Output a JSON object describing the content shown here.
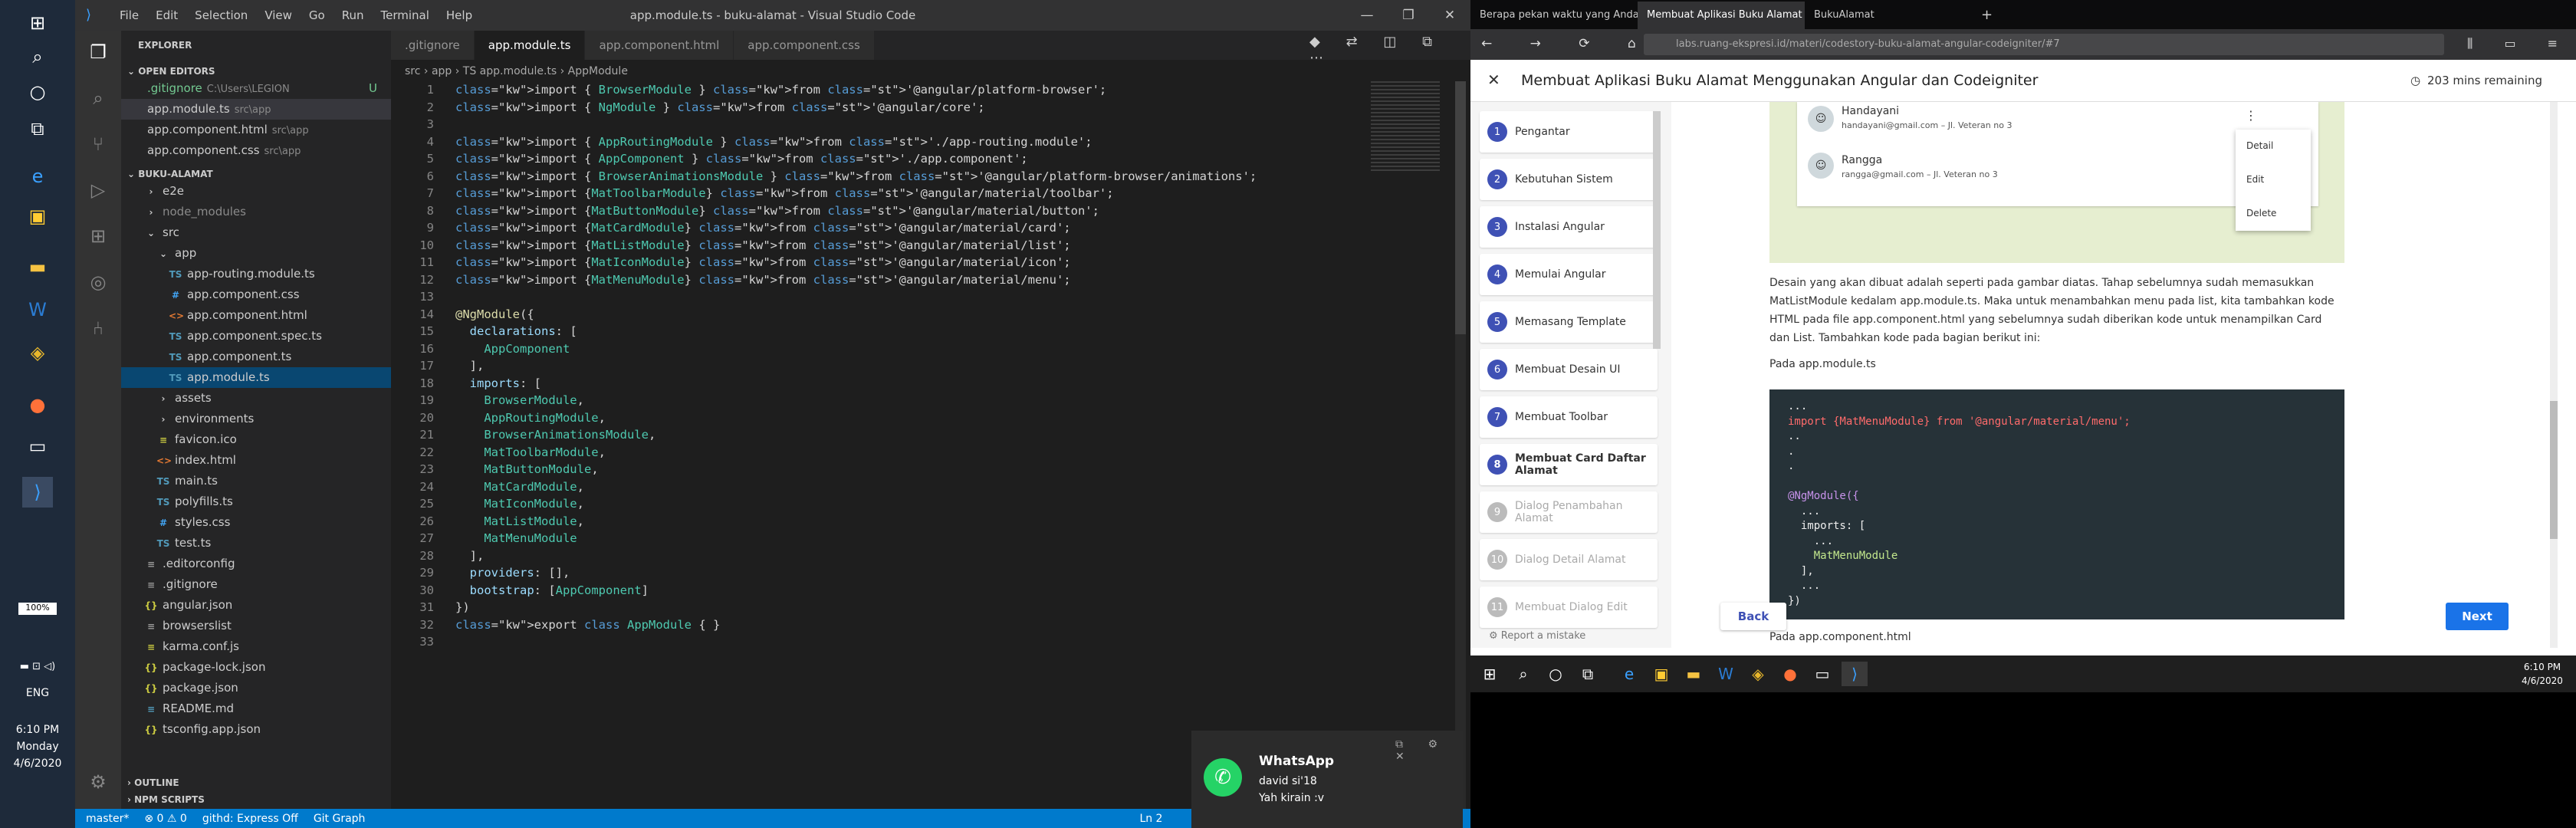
{
  "left_taskbar": {
    "battery": "100%",
    "lang": "ENG",
    "time": "6:10 PM",
    "day": "Monday",
    "date": "4/6/2020"
  },
  "vscode": {
    "menu": [
      "File",
      "Edit",
      "Selection",
      "View",
      "Go",
      "Run",
      "Terminal",
      "Help"
    ],
    "title": "app.module.ts - buku-alamat - Visual Studio Code",
    "tabs": [
      ".gitignore",
      "app.module.ts",
      "app.component.html",
      "app.component.css"
    ],
    "explorer": "EXPLORER",
    "open_editors": "OPEN EDITORS",
    "open_files": [
      {
        "name": ".gitignore",
        "path": "C:\\Users\\LEGION",
        "badge": "U"
      },
      {
        "name": "app.module.ts",
        "path": "src\\app"
      },
      {
        "name": "app.component.html",
        "path": "src\\app"
      },
      {
        "name": "app.component.css",
        "path": "src\\app"
      }
    ],
    "project": "BUKU-ALAMAT",
    "tree": [
      "e2e",
      "node_modules",
      "src",
      "app",
      "app-routing.module.ts",
      "app.component.css",
      "app.component.html",
      "app.component.spec.ts",
      "app.component.ts",
      "app.module.ts",
      "assets",
      "environments",
      "favicon.ico",
      "index.html",
      "main.ts",
      "polyfills.ts",
      "styles.css",
      "test.ts",
      ".editorconfig",
      ".gitignore",
      "angular.json",
      "browserslist",
      "karma.conf.js",
      "package-lock.json",
      "package.json",
      "README.md",
      "tsconfig.app.json"
    ],
    "outline": "OUTLINE",
    "npm": "NPM SCRIPTS",
    "breadcrumb": "src › app › TS app.module.ts › AppModule",
    "code": [
      "import { BrowserModule } from '@angular/platform-browser';",
      "import { NgModule } from '@angular/core';",
      "",
      "import { AppRoutingModule } from './app-routing.module';",
      "import { AppComponent } from './app.component';",
      "import { BrowserAnimationsModule } from '@angular/platform-browser/animations';",
      "import {MatToolbarModule} from '@angular/material/toolbar';",
      "import {MatButtonModule} from '@angular/material/button';",
      "import {MatCardModule} from '@angular/material/card';",
      "import {MatListModule} from '@angular/material/list';",
      "import {MatIconModule} from '@angular/material/icon';",
      "import {MatMenuModule} from '@angular/material/menu';",
      "",
      "@NgModule({",
      "  declarations: [",
      "    AppComponent",
      "  ],",
      "  imports: [",
      "    BrowserModule,",
      "    AppRoutingModule,",
      "    BrowserAnimationsModule,",
      "    MatToolbarModule,",
      "    MatButtonModule,",
      "    MatCardModule,",
      "    MatIconModule,",
      "    MatListModule,",
      "    MatMenuModule",
      "  ],",
      "  providers: [],",
      "  bootstrap: [AppComponent]",
      "})",
      "export class AppModule { }",
      ""
    ],
    "status": {
      "branch": "master*",
      "errors": "⊗ 0 ⚠ 0",
      "github": "githd: Express Off",
      "graph": "Git Graph",
      "pos": "Ln 2"
    },
    "toast": {
      "title": "WhatsApp",
      "line1": "david si'18",
      "line2": "Yah kirain :v"
    }
  },
  "browser": {
    "tabs": [
      "Berapa pekan waktu yang Anda",
      "Membuat Aplikasi Buku Alamat Me",
      "BukuAlamat"
    ],
    "url": "labs.ruang-ekspresi.id/materi/codestory-buku-alamat-angular-codeigniter/#7",
    "course_title": "Membuat Aplikasi Buku Alamat Menggunakan Angular dan Codeigniter",
    "remaining": "203 mins remaining",
    "steps": [
      {
        "n": "1",
        "t": "Pengantar"
      },
      {
        "n": "2",
        "t": "Kebutuhan Sistem"
      },
      {
        "n": "3",
        "t": "Instalasi Angular"
      },
      {
        "n": "4",
        "t": "Memulai Angular"
      },
      {
        "n": "5",
        "t": "Memasang Template"
      },
      {
        "n": "6",
        "t": "Membuat Desain UI"
      },
      {
        "n": "7",
        "t": "Membuat Toolbar"
      },
      {
        "n": "8",
        "t": "Membuat Card Daftar Alamat"
      },
      {
        "n": "9",
        "t": "Dialog Penambahan Alamat"
      },
      {
        "n": "10",
        "t": "Dialog Detail Alamat"
      },
      {
        "n": "11",
        "t": "Membuat Dialog Edit"
      }
    ],
    "report": "Report a mistake",
    "contacts": [
      {
        "name": "Handayani",
        "info": "handayani@gmail.com – Jl. Veteran no 3"
      },
      {
        "name": "Rangga",
        "info": "rangga@gmail.com – Jl. Veteran no 3"
      }
    ],
    "menu": [
      "Detail",
      "Edit",
      "Delete"
    ],
    "para": "Desain yang akan dibuat adalah seperti pada gambar diatas. Tahap sebelumnya sudah memasukkan MatListModule kedalam app.module.ts. Maka untuk menambahkan menu pada list, kita tambahkan kode HTML pada file app.component.html yang sebelumnya sudah diberikan kode untuk menampilkan Card dan List. Tambahkan kode pada bagian berikut ini:",
    "sub1": "Pada app.module.ts",
    "code": [
      "...",
      "import {MatMenuModule} from '@angular/material/menu';",
      "..",
      ".",
      ".",
      "",
      "@NgModule({",
      "  ...",
      "  imports: [",
      "    ...",
      "    MatMenuModule",
      "  ],",
      "  ...",
      "})"
    ],
    "sub2": "Pada app.component.html",
    "back": "Back",
    "next": "Next"
  },
  "win_taskbar": {
    "time": "6:10 PM",
    "date": "4/6/2020"
  }
}
